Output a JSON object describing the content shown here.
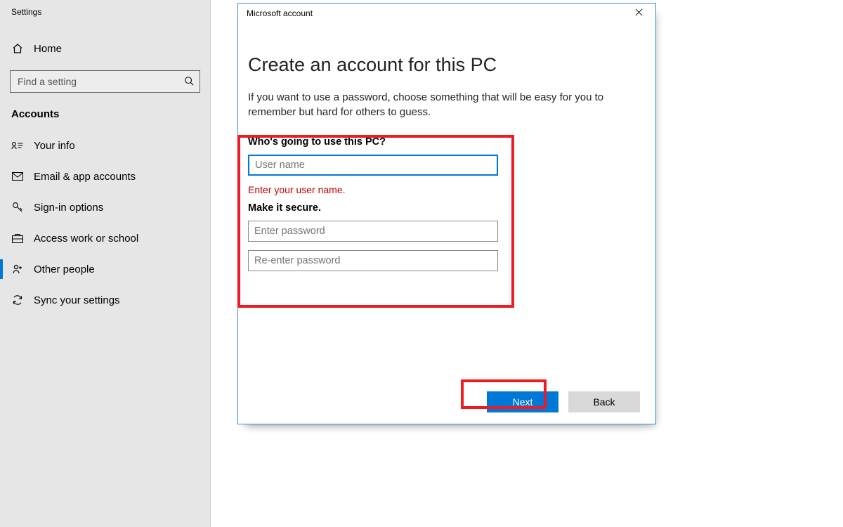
{
  "sidebar": {
    "app_title": "Settings",
    "home_label": "Home",
    "search_placeholder": "Find a setting",
    "category_label": "Accounts",
    "items": [
      {
        "label": "Your info"
      },
      {
        "label": "Email & app accounts"
      },
      {
        "label": "Sign-in options"
      },
      {
        "label": "Access work or school"
      },
      {
        "label": "Other people"
      },
      {
        "label": "Sync your settings"
      }
    ]
  },
  "dialog": {
    "window_title": "Microsoft account",
    "heading": "Create an account for this PC",
    "subtext": "If you want to use a password, choose something that will be easy for you to remember but hard for others to guess.",
    "section_user_label": "Who's going to use this PC?",
    "username_placeholder": "User name",
    "username_value": "",
    "error_text": "Enter your user name.",
    "section_pass_label": "Make it secure.",
    "password_placeholder": "Enter password",
    "password2_placeholder": "Re-enter password",
    "next_label": "Next",
    "back_label": "Back"
  }
}
